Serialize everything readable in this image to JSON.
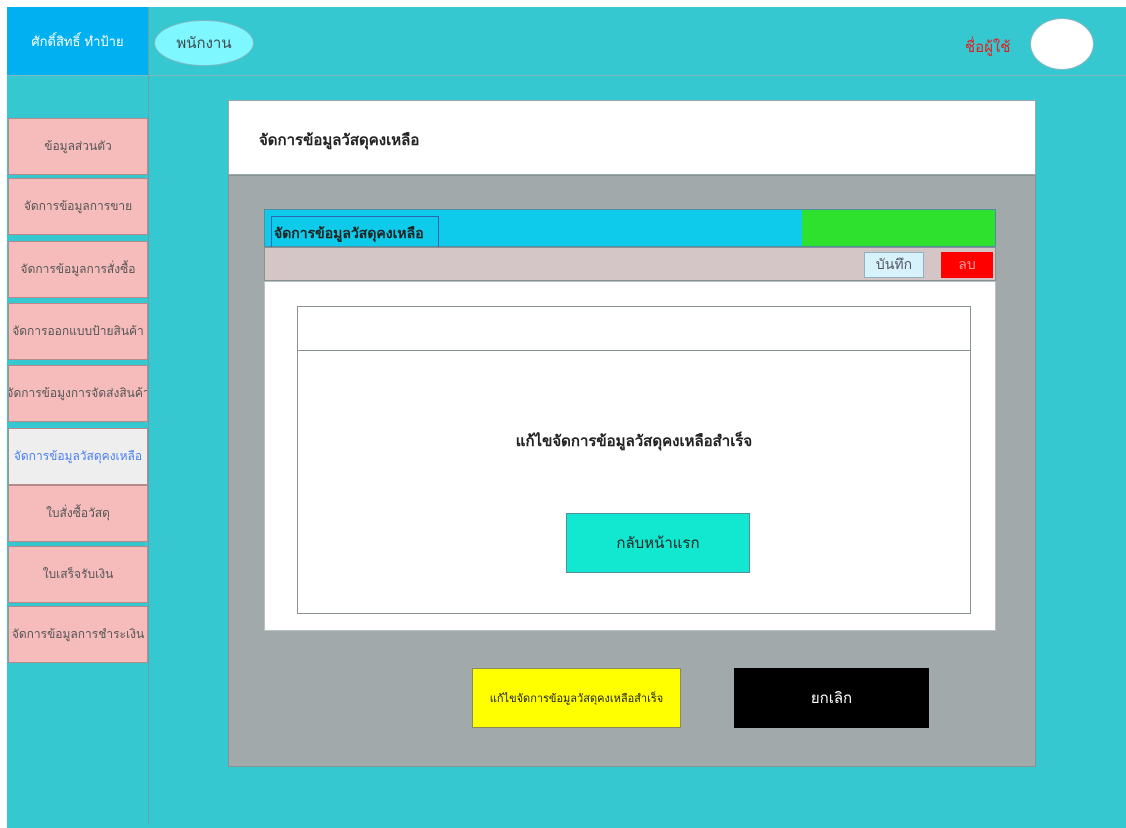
{
  "header": {
    "user_name": "ศักดิ์สิทธิ์ ทำป้าย",
    "role": "พนักงาน",
    "username_label": "ชื่อผู้ใช้"
  },
  "sidebar": {
    "items": [
      {
        "label": "ข้อมูลส่วนตัว"
      },
      {
        "label": "จัดการข้อมูลการขาย"
      },
      {
        "label": "จัดการข้อมูลการสั่งซื้อ"
      },
      {
        "label": "จัดการออกแบบป้ายสินค้า"
      },
      {
        "label": "จัดการข้อมูงการจัดส่งสินค้า"
      },
      {
        "label": "จัดการข้อมูลวัสดุคงเหลือ",
        "active": true
      },
      {
        "label": "ใบสั่งซื้อวัสดุ"
      },
      {
        "label": "ใบเสร็จรับเงิน"
      },
      {
        "label": "จัดการข้อมูลการชำระเงิน"
      }
    ]
  },
  "panel": {
    "title": "จัดการข้อมูลวัสดุคงเหลือ",
    "inner_title": "จัดการข้อมูลวัสดุคงเหลือ",
    "save_label": "บันทึก",
    "delete_label": "ลบ"
  },
  "dialog": {
    "message": "แก้ไขจัดการข้อมูลวัสดุคงเหลือสำเร็จ",
    "home_button": "กลับหน้าแรก"
  },
  "footer": {
    "confirm_label": "แก้ไขจัดการข้อมูลวัสดุคงเหลือสำเร็จ",
    "cancel_label": "ยกเลิก"
  },
  "colors": {
    "background": "#35c8d0",
    "sidebar_item": "#f6bcbc",
    "inner_bar": "#0ecbec",
    "green_block": "#2ee12e",
    "delete": "#ff0000",
    "home_button": "#12e7cf",
    "confirm_button": "#ffff00",
    "cancel_button": "#000000"
  }
}
